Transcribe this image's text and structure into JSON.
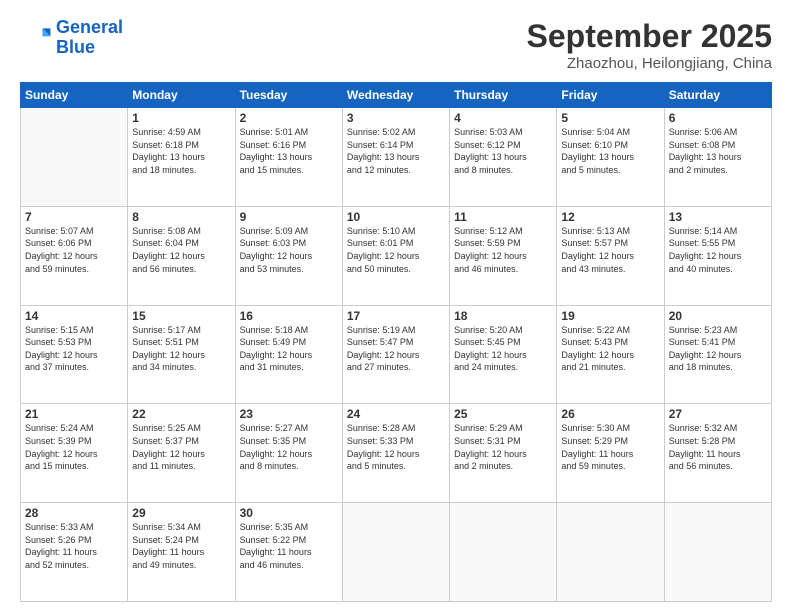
{
  "header": {
    "logo_general": "General",
    "logo_blue": "Blue",
    "month_title": "September 2025",
    "location": "Zhaozhou, Heilongjiang, China"
  },
  "days_of_week": [
    "Sunday",
    "Monday",
    "Tuesday",
    "Wednesday",
    "Thursday",
    "Friday",
    "Saturday"
  ],
  "weeks": [
    [
      {
        "day": "",
        "info": ""
      },
      {
        "day": "1",
        "info": "Sunrise: 4:59 AM\nSunset: 6:18 PM\nDaylight: 13 hours\nand 18 minutes."
      },
      {
        "day": "2",
        "info": "Sunrise: 5:01 AM\nSunset: 6:16 PM\nDaylight: 13 hours\nand 15 minutes."
      },
      {
        "day": "3",
        "info": "Sunrise: 5:02 AM\nSunset: 6:14 PM\nDaylight: 13 hours\nand 12 minutes."
      },
      {
        "day": "4",
        "info": "Sunrise: 5:03 AM\nSunset: 6:12 PM\nDaylight: 13 hours\nand 8 minutes."
      },
      {
        "day": "5",
        "info": "Sunrise: 5:04 AM\nSunset: 6:10 PM\nDaylight: 13 hours\nand 5 minutes."
      },
      {
        "day": "6",
        "info": "Sunrise: 5:06 AM\nSunset: 6:08 PM\nDaylight: 13 hours\nand 2 minutes."
      }
    ],
    [
      {
        "day": "7",
        "info": "Sunrise: 5:07 AM\nSunset: 6:06 PM\nDaylight: 12 hours\nand 59 minutes."
      },
      {
        "day": "8",
        "info": "Sunrise: 5:08 AM\nSunset: 6:04 PM\nDaylight: 12 hours\nand 56 minutes."
      },
      {
        "day": "9",
        "info": "Sunrise: 5:09 AM\nSunset: 6:03 PM\nDaylight: 12 hours\nand 53 minutes."
      },
      {
        "day": "10",
        "info": "Sunrise: 5:10 AM\nSunset: 6:01 PM\nDaylight: 12 hours\nand 50 minutes."
      },
      {
        "day": "11",
        "info": "Sunrise: 5:12 AM\nSunset: 5:59 PM\nDaylight: 12 hours\nand 46 minutes."
      },
      {
        "day": "12",
        "info": "Sunrise: 5:13 AM\nSunset: 5:57 PM\nDaylight: 12 hours\nand 43 minutes."
      },
      {
        "day": "13",
        "info": "Sunrise: 5:14 AM\nSunset: 5:55 PM\nDaylight: 12 hours\nand 40 minutes."
      }
    ],
    [
      {
        "day": "14",
        "info": "Sunrise: 5:15 AM\nSunset: 5:53 PM\nDaylight: 12 hours\nand 37 minutes."
      },
      {
        "day": "15",
        "info": "Sunrise: 5:17 AM\nSunset: 5:51 PM\nDaylight: 12 hours\nand 34 minutes."
      },
      {
        "day": "16",
        "info": "Sunrise: 5:18 AM\nSunset: 5:49 PM\nDaylight: 12 hours\nand 31 minutes."
      },
      {
        "day": "17",
        "info": "Sunrise: 5:19 AM\nSunset: 5:47 PM\nDaylight: 12 hours\nand 27 minutes."
      },
      {
        "day": "18",
        "info": "Sunrise: 5:20 AM\nSunset: 5:45 PM\nDaylight: 12 hours\nand 24 minutes."
      },
      {
        "day": "19",
        "info": "Sunrise: 5:22 AM\nSunset: 5:43 PM\nDaylight: 12 hours\nand 21 minutes."
      },
      {
        "day": "20",
        "info": "Sunrise: 5:23 AM\nSunset: 5:41 PM\nDaylight: 12 hours\nand 18 minutes."
      }
    ],
    [
      {
        "day": "21",
        "info": "Sunrise: 5:24 AM\nSunset: 5:39 PM\nDaylight: 12 hours\nand 15 minutes."
      },
      {
        "day": "22",
        "info": "Sunrise: 5:25 AM\nSunset: 5:37 PM\nDaylight: 12 hours\nand 11 minutes."
      },
      {
        "day": "23",
        "info": "Sunrise: 5:27 AM\nSunset: 5:35 PM\nDaylight: 12 hours\nand 8 minutes."
      },
      {
        "day": "24",
        "info": "Sunrise: 5:28 AM\nSunset: 5:33 PM\nDaylight: 12 hours\nand 5 minutes."
      },
      {
        "day": "25",
        "info": "Sunrise: 5:29 AM\nSunset: 5:31 PM\nDaylight: 12 hours\nand 2 minutes."
      },
      {
        "day": "26",
        "info": "Sunrise: 5:30 AM\nSunset: 5:29 PM\nDaylight: 11 hours\nand 59 minutes."
      },
      {
        "day": "27",
        "info": "Sunrise: 5:32 AM\nSunset: 5:28 PM\nDaylight: 11 hours\nand 56 minutes."
      }
    ],
    [
      {
        "day": "28",
        "info": "Sunrise: 5:33 AM\nSunset: 5:26 PM\nDaylight: 11 hours\nand 52 minutes."
      },
      {
        "day": "29",
        "info": "Sunrise: 5:34 AM\nSunset: 5:24 PM\nDaylight: 11 hours\nand 49 minutes."
      },
      {
        "day": "30",
        "info": "Sunrise: 5:35 AM\nSunset: 5:22 PM\nDaylight: 11 hours\nand 46 minutes."
      },
      {
        "day": "",
        "info": ""
      },
      {
        "day": "",
        "info": ""
      },
      {
        "day": "",
        "info": ""
      },
      {
        "day": "",
        "info": ""
      }
    ]
  ]
}
